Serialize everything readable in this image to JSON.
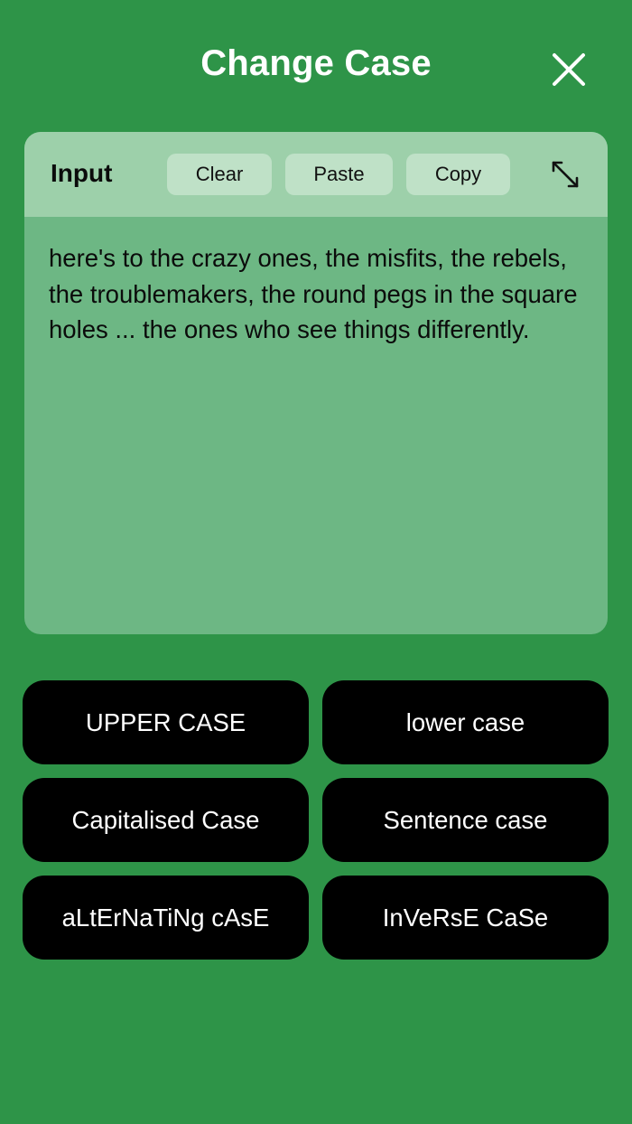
{
  "header": {
    "title": "Change Case",
    "close_icon": "close-icon"
  },
  "input_panel": {
    "label": "Input",
    "clear_label": "Clear",
    "paste_label": "Paste",
    "copy_label": "Copy",
    "expand_icon": "expand-icon",
    "text": "here's to the crazy ones, the misfits, the rebels, the troublemakers, the round pegs in the square holes ... the ones who see things differently."
  },
  "case_buttons": {
    "upper": "UPPER CASE",
    "lower": "lower case",
    "capitalised": "Capitalised Case",
    "sentence": "Sentence case",
    "alternating": "aLtErNaTiNg cAsE",
    "inverse": "InVeRsE CaSe"
  },
  "colors": {
    "background": "#2e9448",
    "panel_header": "#9dd0aa",
    "panel_body": "#6db784",
    "header_button": "#bfe1c7",
    "case_button": "#000000",
    "case_button_text": "#ffffff"
  }
}
